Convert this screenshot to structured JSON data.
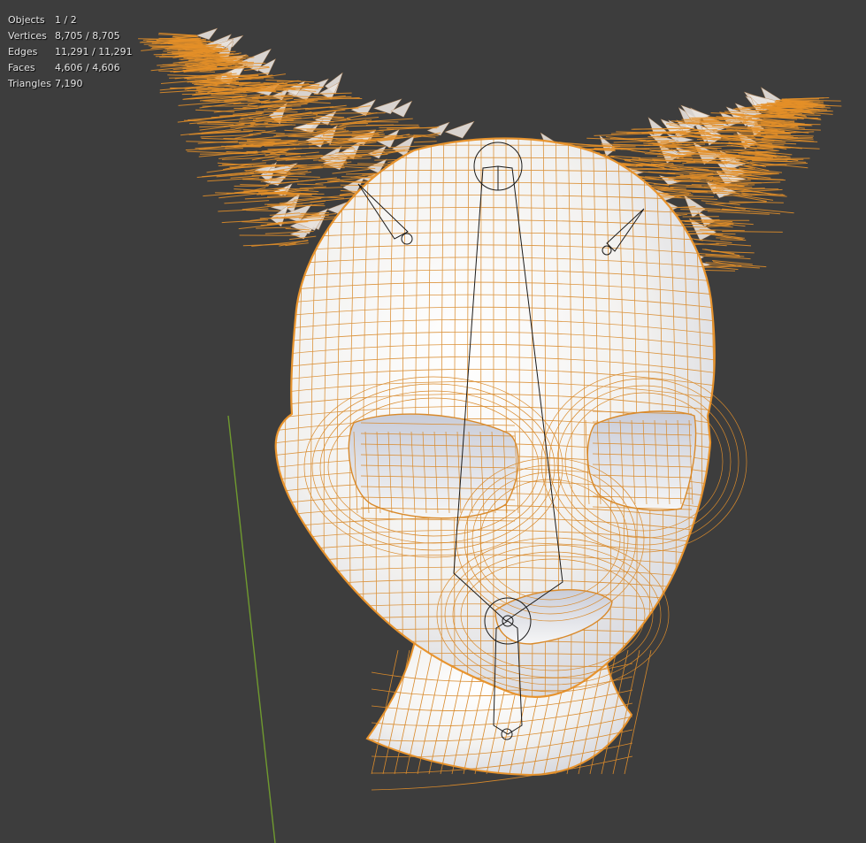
{
  "overlay_stats": [
    {
      "label": "Objects",
      "value": "1 / 2"
    },
    {
      "label": "Vertices",
      "value": "8,705 / 8,705"
    },
    {
      "label": "Edges",
      "value": "11,291 / 11,291"
    },
    {
      "label": "Faces",
      "value": "4,606 / 4,606"
    },
    {
      "label": "Triangles",
      "value": "7,190"
    }
  ],
  "colors": {
    "background": "#3d3d3d",
    "wireframe": "#d98a2b",
    "selection_outline": "#e8942e",
    "mesh_base": "#f4f3f1",
    "mesh_shadow": "#cfd2dc",
    "fur": "#e59028",
    "y_axis": "#6f9a2f",
    "armature": "#1a1a1a",
    "stats_text": "#e6e6e6"
  },
  "viewport": {
    "objects": [
      "head-mask-mesh",
      "fur-ears",
      "armature"
    ]
  }
}
